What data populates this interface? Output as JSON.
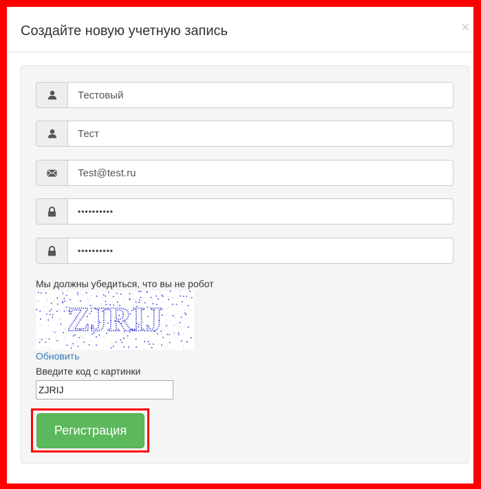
{
  "modal": {
    "title": "Создайте новую учетную запись",
    "close_symbol": "×"
  },
  "form": {
    "fields": [
      {
        "icon": "user-icon",
        "value": "Тестовый"
      },
      {
        "icon": "user-icon",
        "value": "Тест"
      },
      {
        "icon": "envelope-icon",
        "value": "Test@test.ru"
      },
      {
        "icon": "lock-icon",
        "value": "••••••••••"
      },
      {
        "icon": "lock-icon",
        "value": "••••••••••"
      }
    ],
    "robot_text": "Мы должны убедиться, что вы не робот",
    "captcha_text": "ZJRIJ",
    "refresh_label": "Обновить",
    "code_label": "Введите код с картинки",
    "code_value": "ZJRIJ",
    "submit_label": "Регистрация"
  },
  "colors": {
    "highlight": "#ff0000",
    "button": "#5cb85c",
    "link": "#337ab7",
    "captcha_ink": "#1a1ad6"
  }
}
